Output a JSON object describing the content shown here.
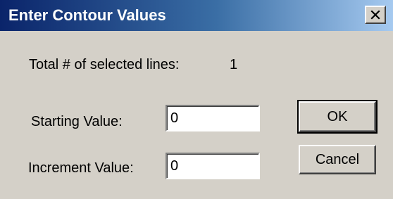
{
  "window": {
    "title": "Enter Contour Values",
    "close_icon": "close-icon"
  },
  "summary": {
    "total_label": "Total # of selected lines:",
    "total_value": "1"
  },
  "fields": {
    "starting_label": "Starting Value:",
    "starting_value": "0",
    "increment_label": "Increment Value:",
    "increment_value": "0"
  },
  "buttons": {
    "ok_label": "OK",
    "cancel_label": "Cancel"
  },
  "colors": {
    "face": "#d4d0c8",
    "titlebar_start": "#0a246a",
    "titlebar_end": "#a6caf0"
  }
}
